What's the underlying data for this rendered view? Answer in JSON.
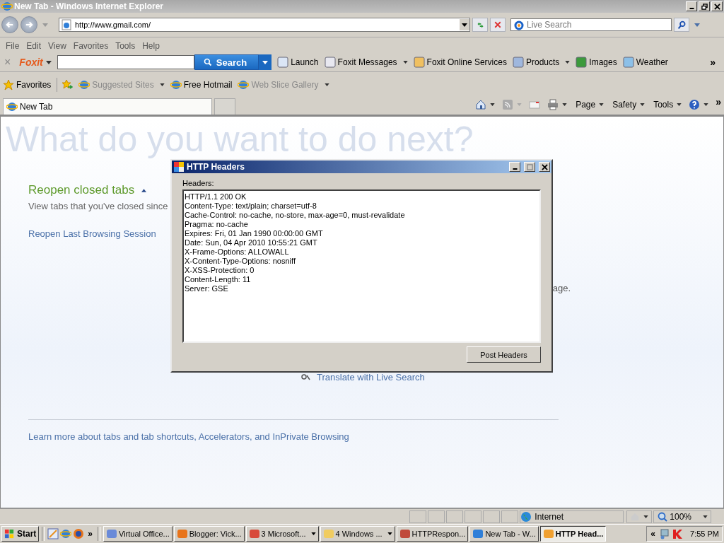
{
  "window": {
    "title": "New Tab - Windows Internet Explorer"
  },
  "address": {
    "url": "http://www.gmail.com/"
  },
  "search": {
    "placeholder": "Live Search"
  },
  "menu": [
    "File",
    "Edit",
    "View",
    "Favorites",
    "Tools",
    "Help"
  ],
  "foxit_toolbar": {
    "close": "×",
    "logo": "Foxit",
    "search_button": "Search",
    "chevron": "»",
    "items": [
      {
        "label": "Launch",
        "dropdown": false
      },
      {
        "label": "Foxit Messages",
        "dropdown": true
      },
      {
        "label": "Foxit Online Services",
        "dropdown": false
      },
      {
        "label": "Products",
        "dropdown": true
      },
      {
        "label": "Images",
        "dropdown": false
      },
      {
        "label": "Weather",
        "dropdown": false
      }
    ]
  },
  "favorites_bar": {
    "label": "Favorites",
    "items": [
      {
        "label": "Suggested Sites",
        "disabled": true,
        "dropdown": true
      },
      {
        "label": "Free Hotmail",
        "disabled": false,
        "dropdown": false
      },
      {
        "label": "Web Slice Gallery",
        "disabled": true,
        "dropdown": true
      }
    ]
  },
  "tabs": [
    {
      "label": "New Tab",
      "selected": true
    }
  ],
  "command_bar": {
    "items": [
      "Page",
      "Safety",
      "Tools"
    ],
    "chevron": "»"
  },
  "page": {
    "heading": "What do you want to do next?",
    "section_title": "Reopen closed tabs",
    "section_text": "View tabs that you've closed since",
    "reopen_link": "Reopen Last Browsing Session",
    "fragment": "age.",
    "translate_link": "Translate with Live Search",
    "footer_link": "Learn more about tabs and tab shortcuts, Accelerators, and InPrivate Browsing"
  },
  "dialog": {
    "title": "HTTP Headers",
    "label": "Headers:",
    "lines": [
      "HTTP/1.1 200 OK",
      "Content-Type: text/plain; charset=utf-8",
      "Cache-Control: no-cache, no-store, max-age=0, must-revalidate",
      "Pragma: no-cache",
      "Expires: Fri, 01 Jan 1990 00:00:00 GMT",
      "Date: Sun, 04 Apr 2010 10:55:21 GMT",
      "X-Frame-Options: ALLOWALL",
      "X-Content-Type-Options: nosniff",
      "X-XSS-Protection: 0",
      "Content-Length: 11",
      "Server: GSE"
    ],
    "button": "Post Headers"
  },
  "status_bar": {
    "zone": "Internet",
    "zoom": "100%"
  },
  "taskbar": {
    "start": "Start",
    "quick_chevron": "»",
    "tasks": [
      {
        "label": "Virtual Office...",
        "selected": false,
        "dropdown": false
      },
      {
        "label": "Blogger: Vick...",
        "selected": false,
        "dropdown": false
      },
      {
        "label": "3 Microsoft...",
        "selected": false,
        "dropdown": true
      },
      {
        "label": "4 Windows ...",
        "selected": false,
        "dropdown": true
      },
      {
        "label": "HTTPRespon...",
        "selected": false,
        "dropdown": false
      },
      {
        "label": "New Tab - W...",
        "selected": false,
        "dropdown": false
      },
      {
        "label": "HTTP Head...",
        "selected": true,
        "dropdown": false
      }
    ],
    "tray_chevron": "«",
    "clock": "7:55 PM"
  }
}
